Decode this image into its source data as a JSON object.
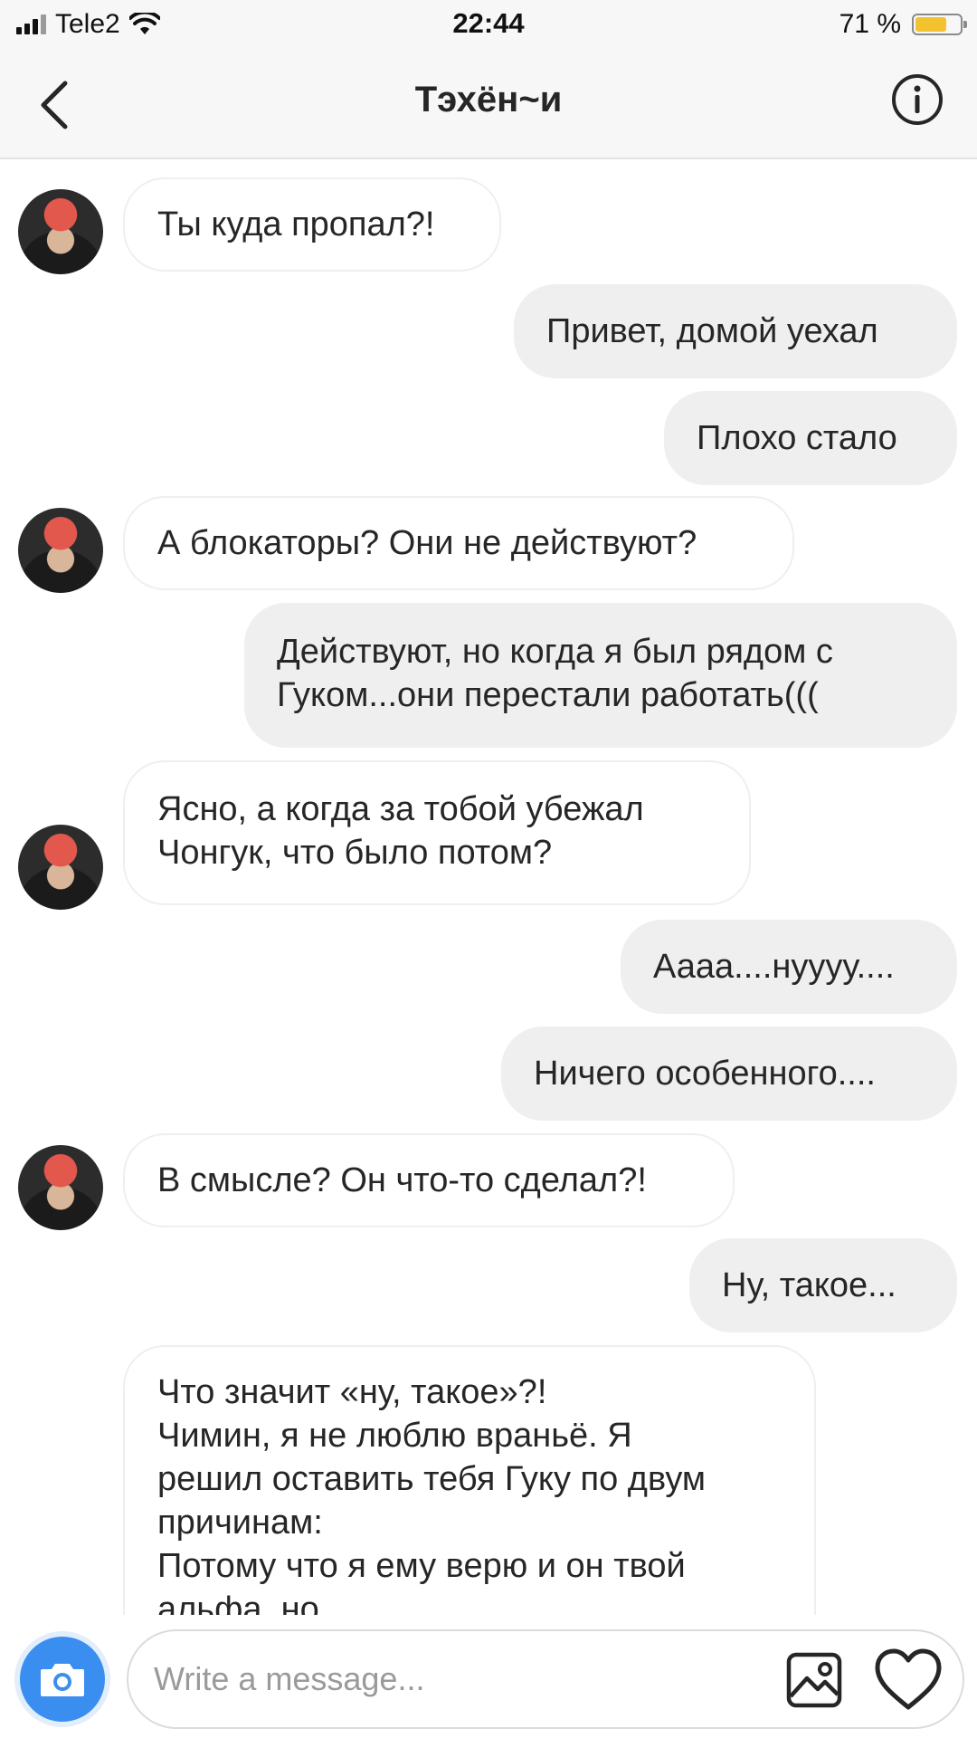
{
  "status_bar": {
    "carrier": "Tele2",
    "time": "22:44",
    "battery": "71 %",
    "battery_level": 0.71,
    "icons": [
      "signal-icon",
      "wifi-icon",
      "battery-icon"
    ]
  },
  "header": {
    "title": "Тэхён~и",
    "icons": [
      "back-arrow-icon",
      "info-icon"
    ]
  },
  "messages": [
    {
      "from": "them",
      "lines": [
        "Ты куда пропал?!"
      ]
    },
    {
      "from": "me",
      "lines": [
        "Привет, домой уехал"
      ]
    },
    {
      "from": "me",
      "lines": [
        "Плохо стало"
      ]
    },
    {
      "from": "them",
      "lines": [
        "А блокаторы? Они не действуют?"
      ]
    },
    {
      "from": "me",
      "lines": [
        "Действуют, но когда я был рядом с",
        "Гуком...они перестали работать((("
      ]
    },
    {
      "from": "them",
      "lines": [
        "Ясно, а когда за тобой убежал",
        "Чонгук, что было потом?"
      ]
    },
    {
      "from": "me",
      "lines": [
        "Аааа....нуууу...."
      ]
    },
    {
      "from": "me",
      "lines": [
        "Ничего особенного...."
      ]
    },
    {
      "from": "them",
      "lines": [
        "В смысле? Он что-то сделал?!"
      ]
    },
    {
      "from": "me",
      "lines": [
        "Ну, такое..."
      ]
    },
    {
      "from": "them",
      "lines": [
        "Что значит «ну, такое»?!",
        "Чимин, я не люблю враньё. Я",
        "решил оставить тебя Гуку по двум",
        "причинам:",
        "Потому что я ему верю и он твой",
        "альфа, но"
      ]
    }
  ],
  "composer": {
    "placeholder": "Write a message...",
    "icons": [
      "camera-icon",
      "gallery-icon",
      "heart-icon"
    ]
  },
  "colors": {
    "camera_button": "#3a8ef0",
    "outgoing_bubble": "#efefef",
    "battery_fill": "#f2c230",
    "text": "#262626"
  }
}
